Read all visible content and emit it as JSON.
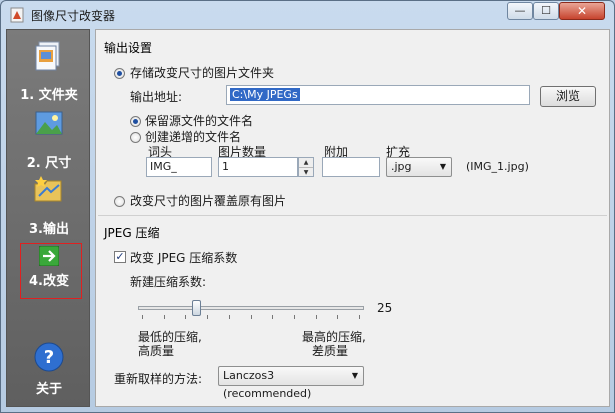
{
  "window": {
    "title": "图像尺寸改变器"
  },
  "controls": {
    "minimize": "—",
    "maximize": "☐",
    "close": "✕"
  },
  "sidebar": {
    "items": [
      {
        "label": "1. 文件夹",
        "icon": "folder-document-icon"
      },
      {
        "label": "2. 尺寸",
        "icon": "picture-resize-icon"
      },
      {
        "label": "3.输出",
        "icon": "output-folder-icon"
      },
      {
        "label": "4.改变",
        "icon": "green-arrow-icon"
      },
      {
        "label": "关于",
        "icon": "help-icon"
      }
    ]
  },
  "output": {
    "group_title": "输出设置",
    "radio_store_label": "存储改变尺寸的图片文件夹",
    "path_label": "输出地址:",
    "path_value": "C:\\My JPEGs",
    "browse_label": "浏览",
    "keep_name_label": "保留源文件的文件名",
    "increment_name_label": "创建递增的文件名",
    "prefix_label": "词头",
    "prefix_value": "IMG_",
    "count_label": "图片数量",
    "count_value": "1",
    "suffix_label": "附加",
    "suffix_value": "",
    "ext_label": "扩充",
    "ext_value": ".jpg",
    "example": "(IMG_1.jpg)",
    "overwrite_label": "改变尺寸的图片覆盖原有图片"
  },
  "jpeg": {
    "group_title": "JPEG 压缩",
    "checkbox_label": "改变 JPEG 压缩系数",
    "factor_label": "新建压缩系数:",
    "slider_value": 25,
    "slider_fraction": 0.25,
    "low_label_1": "最低的压缩,",
    "low_label_2": "高质量",
    "high_label_1": "最高的压缩,",
    "high_label_2": "差质量",
    "resample_label": "重新取样的方法:",
    "resample_value": "Lanczos3 (recommended)"
  }
}
